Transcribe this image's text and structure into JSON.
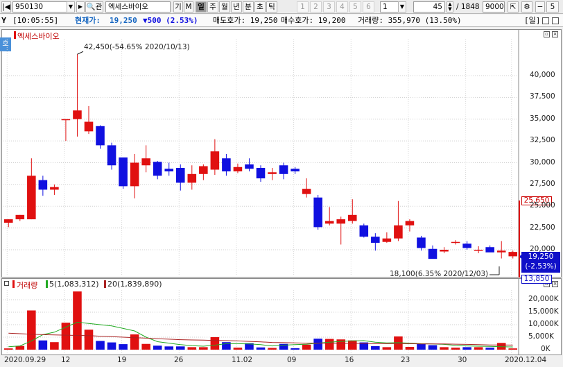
{
  "toolbar": {
    "code": "950130",
    "name": "엑세스바이오",
    "icons_left": [
      "◀",
      "▶",
      "🔍",
      "관"
    ],
    "gi": "기",
    "m": "M",
    "periods": [
      "일",
      "주",
      "월",
      "년",
      "분",
      "초",
      "틱"
    ],
    "active_period": "일",
    "multi": [
      "1",
      "2",
      "3",
      "4",
      "5",
      "6"
    ],
    "multi_select": "1",
    "count": "45",
    "total": "/ 1848",
    "total_val": "9000"
  },
  "infobar": {
    "time": "[10:05:55]",
    "cur_label": "현재가:",
    "cur_value": "19,250",
    "change": "▼500 (2.53%)",
    "ask_label": "매도호가: 19,250",
    "bid_label": "매수호가: 19,200",
    "vol_label": "거래량: 355,970 (13.50%)",
    "period_tag": "[일]"
  },
  "price_panel": {
    "stock_label": "엑세스바이오",
    "side_tab": "호",
    "high_annotation": "42,450(-54.65% 2020/10/13)",
    "low_annotation": "18,100(6.35% 2020/12/03)",
    "last_box": "25,650",
    "current_box_1": "19,250",
    "current_box_2": "(-2.53%)",
    "low_box": "13,850",
    "yticks": [
      "40,000",
      "37,500",
      "35,000",
      "32,500",
      "30,000",
      "27,500",
      "25,000",
      "22,500",
      "20,000"
    ]
  },
  "volume_panel": {
    "label": "거래량",
    "ma5": "5(1,083,312)",
    "ma20": "20(1,839,890)",
    "yticks": [
      "20,000K",
      "15,000K",
      "10,000K",
      "5,000K",
      "0K"
    ]
  },
  "xaxis": [
    "2020.09.29",
    "12",
    "19",
    "26",
    "11.02",
    "09",
    "16",
    "23",
    "30",
    "2020.12.04"
  ],
  "colors": {
    "up": "#e01010",
    "down": "#1010e0",
    "ma5": "#22aa22",
    "ma20": "#aa2222"
  },
  "chart_data": {
    "type": "candlestick",
    "ylim": [
      19000,
      42500
    ],
    "vol_ylim": [
      0,
      23500000
    ],
    "candles": [
      {
        "o": 23100,
        "h": 23500,
        "l": 22600,
        "c": 23500,
        "v": 500000
      },
      {
        "o": 23500,
        "h": 24000,
        "l": 23300,
        "c": 24000,
        "v": 1500000
      },
      {
        "o": 23500,
        "h": 30500,
        "l": 23500,
        "c": 28500,
        "v": 15700000
      },
      {
        "o": 28000,
        "h": 28500,
        "l": 26200,
        "c": 26900,
        "v": 3700000
      },
      {
        "o": 26900,
        "h": 27500,
        "l": 26300,
        "c": 27200,
        "v": 3000000
      },
      {
        "o": 35000,
        "h": 35000,
        "l": 32500,
        "c": 35000,
        "v": 10800000
      },
      {
        "o": 35000,
        "h": 42450,
        "l": 33000,
        "c": 36000,
        "v": 23300000
      },
      {
        "o": 33600,
        "h": 36500,
        "l": 33300,
        "c": 34700,
        "v": 8000000
      },
      {
        "o": 34200,
        "h": 34300,
        "l": 31600,
        "c": 32000,
        "v": 3500000
      },
      {
        "o": 32000,
        "h": 32300,
        "l": 29200,
        "c": 29700,
        "v": 2900000
      },
      {
        "o": 30600,
        "h": 30600,
        "l": 27000,
        "c": 27300,
        "v": 2200000
      },
      {
        "o": 27300,
        "h": 31000,
        "l": 25900,
        "c": 30000,
        "v": 6100000
      },
      {
        "o": 29700,
        "h": 32000,
        "l": 28900,
        "c": 30500,
        "v": 2300000
      },
      {
        "o": 30100,
        "h": 30200,
        "l": 28100,
        "c": 28500,
        "v": 1600000
      },
      {
        "o": 29300,
        "h": 30000,
        "l": 28500,
        "c": 29000,
        "v": 1300000
      },
      {
        "o": 29400,
        "h": 29800,
        "l": 26800,
        "c": 27700,
        "v": 1300000
      },
      {
        "o": 27700,
        "h": 29700,
        "l": 26900,
        "c": 28700,
        "v": 1000000
      },
      {
        "o": 28700,
        "h": 29800,
        "l": 28000,
        "c": 29600,
        "v": 1000000
      },
      {
        "o": 29200,
        "h": 32700,
        "l": 28600,
        "c": 31300,
        "v": 5000000
      },
      {
        "o": 30500,
        "h": 31000,
        "l": 28500,
        "c": 29000,
        "v": 3000000
      },
      {
        "o": 29000,
        "h": 29900,
        "l": 28800,
        "c": 29500,
        "v": 800000
      },
      {
        "o": 29800,
        "h": 30500,
        "l": 29000,
        "c": 29300,
        "v": 2600000
      },
      {
        "o": 29400,
        "h": 29700,
        "l": 27800,
        "c": 28200,
        "v": 900000
      },
      {
        "o": 28700,
        "h": 29400,
        "l": 28000,
        "c": 28900,
        "v": 700000
      },
      {
        "o": 29700,
        "h": 30000,
        "l": 28100,
        "c": 28700,
        "v": 2300000
      },
      {
        "o": 29300,
        "h": 29500,
        "l": 28700,
        "c": 29000,
        "v": 600000
      },
      {
        "o": 26400,
        "h": 28200,
        "l": 26000,
        "c": 27000,
        "v": 2000000
      },
      {
        "o": 26000,
        "h": 26300,
        "l": 22300,
        "c": 22600,
        "v": 4400000
      },
      {
        "o": 23000,
        "h": 24900,
        "l": 22800,
        "c": 23300,
        "v": 4300000
      },
      {
        "o": 23000,
        "h": 23800,
        "l": 20600,
        "c": 23500,
        "v": 4100000
      },
      {
        "o": 23300,
        "h": 25800,
        "l": 23000,
        "c": 24000,
        "v": 3700000
      },
      {
        "o": 22800,
        "h": 23000,
        "l": 21400,
        "c": 21500,
        "v": 2900000
      },
      {
        "o": 21500,
        "h": 21900,
        "l": 19900,
        "c": 20800,
        "v": 1400000
      },
      {
        "o": 20900,
        "h": 22000,
        "l": 20800,
        "c": 21300,
        "v": 1000000
      },
      {
        "o": 21300,
        "h": 25600,
        "l": 21000,
        "c": 22800,
        "v": 5300000
      },
      {
        "o": 22800,
        "h": 23500,
        "l": 22100,
        "c": 23300,
        "v": 1100000
      },
      {
        "o": 21400,
        "h": 21600,
        "l": 19900,
        "c": 20200,
        "v": 2500000
      },
      {
        "o": 20100,
        "h": 20500,
        "l": 19200,
        "c": 18950,
        "v": 1800000
      },
      {
        "o": 19800,
        "h": 20300,
        "l": 19600,
        "c": 20000,
        "v": 1000000
      },
      {
        "o": 20800,
        "h": 21100,
        "l": 20600,
        "c": 20900,
        "v": 800000
      },
      {
        "o": 20700,
        "h": 21000,
        "l": 20000,
        "c": 20200,
        "v": 1000000
      },
      {
        "o": 19900,
        "h": 20400,
        "l": 19600,
        "c": 20000,
        "v": 1000000
      },
      {
        "o": 20300,
        "h": 20500,
        "l": 19800,
        "c": 19700,
        "v": 800000
      },
      {
        "o": 19700,
        "h": 21000,
        "l": 19000,
        "c": 19900,
        "v": 2700000
      },
      {
        "o": 19250,
        "h": 19900,
        "l": 19000,
        "c": 19750,
        "v": 500000
      }
    ],
    "ma5": [
      1200000,
      1500000,
      3500000,
      6000000,
      7000000,
      9000000,
      11000000,
      10500000,
      10000000,
      9500000,
      8500000,
      7500000,
      5000000,
      3200000,
      2600000,
      2000000,
      1600000,
      1400000,
      1800000,
      2400000,
      2400000,
      2300000,
      2000000,
      1500000,
      1800000,
      2000000,
      2200000,
      2600000,
      3000000,
      3300000,
      3500000,
      3600000,
      3000000,
      2700000,
      2800000,
      2600000,
      2400000,
      2300000,
      2100000,
      1700000,
      1500000,
      1400000,
      1300000,
      1200000,
      1083312
    ],
    "ma20": [
      6600000,
      6400000,
      6200000,
      6000000,
      5900000,
      5800000,
      5700000,
      5600000,
      5400000,
      5200000,
      5000000,
      4800000,
      4600000,
      4400000,
      4200000,
      4000000,
      3900000,
      3800000,
      3700000,
      3600000,
      3500000,
      3300000,
      3100000,
      2900000,
      2800000,
      2700000,
      2600000,
      2600000,
      2600000,
      2500000,
      2500000,
      2500000,
      2400000,
      2400000,
      2400000,
      2400000,
      2300000,
      2300000,
      2300000,
      2200000,
      2100000,
      2000000,
      1900000,
      1900000,
      1839890
    ]
  }
}
